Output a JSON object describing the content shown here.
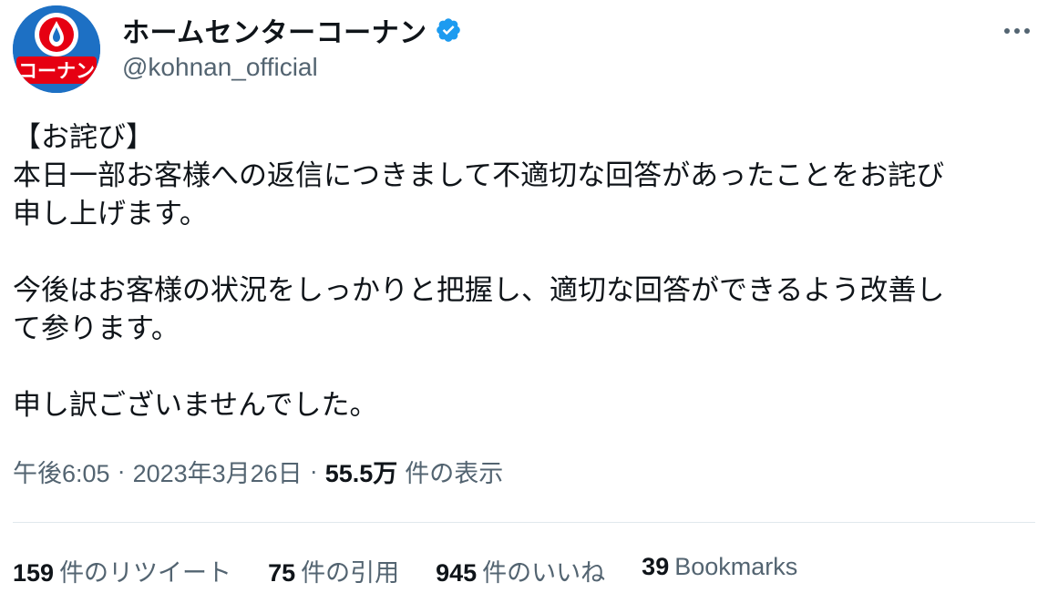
{
  "account": {
    "avatar_text": "コーナン",
    "display_name": "ホームセンターコーナン",
    "handle": "@kohnan_official",
    "verified": true
  },
  "tweet": {
    "lines": [
      "【お詫び】",
      "本日一部お客様への返信につきまして不適切な回答があったことをお詫び",
      "申し上げます。",
      "",
      "今後はお客様の状況をしっかりと把握し、適切な回答ができるよう改善し",
      "て参ります。",
      "",
      "申し訳ございませんでした。"
    ]
  },
  "meta": {
    "time": "午後6:05",
    "separator": "·",
    "date": "2023年3月26日",
    "views_count": "55.5万",
    "views_label": "件の表示"
  },
  "stats": {
    "retweets": {
      "count": "159",
      "label": "件のリツイート"
    },
    "quotes": {
      "count": "75",
      "label": "件の引用"
    },
    "likes": {
      "count": "945",
      "label": "件のいいね"
    },
    "bookmarks": {
      "count": "39",
      "label": "Bookmarks"
    }
  },
  "colors": {
    "avatar_bg": "#1d70c4",
    "avatar_red": "#e60012",
    "verified_blue": "#1d9bf0",
    "secondary_text": "#536471",
    "primary_text": "#0f1419"
  },
  "icons": {
    "verified": "verified-badge-icon",
    "more": "more-horizontal-icon"
  }
}
